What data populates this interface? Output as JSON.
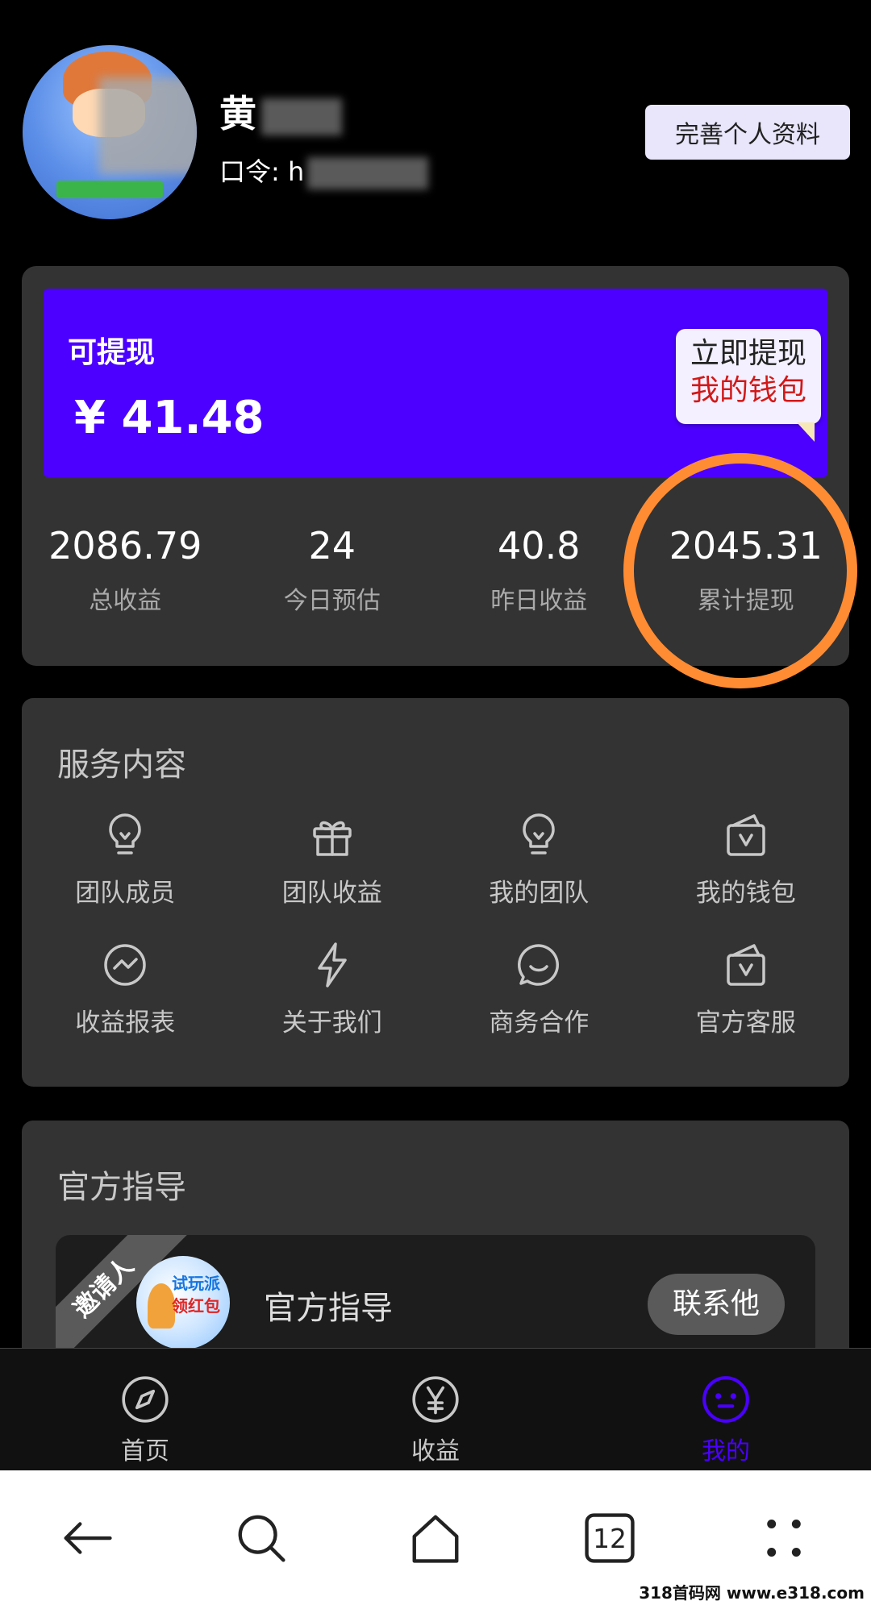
{
  "header": {
    "user_name_visible": "黄",
    "code_label": "口令: h",
    "profile_button": "完善个人资料"
  },
  "earnings": {
    "withdrawable_label": "可提现",
    "withdrawable_amount": "¥ 41.48",
    "withdraw_button_line1": "立即提现",
    "withdraw_button_line2": "我的钱包",
    "stats": [
      {
        "value": "2086.79",
        "label": "总收益"
      },
      {
        "value": "24",
        "label": "今日预估"
      },
      {
        "value": "40.8",
        "label": "昨日收益"
      },
      {
        "value": "2045.31",
        "label": "累计提现"
      }
    ]
  },
  "services": {
    "title": "服务内容",
    "items": [
      {
        "label": "团队成员",
        "icon": "lightbulb-icon"
      },
      {
        "label": "团队收益",
        "icon": "gift-icon"
      },
      {
        "label": "我的团队",
        "icon": "lightbulb-icon"
      },
      {
        "label": "我的钱包",
        "icon": "wallet-icon"
      },
      {
        "label": "收益报表",
        "icon": "chart-icon"
      },
      {
        "label": "关于我们",
        "icon": "lightning-icon"
      },
      {
        "label": "商务合作",
        "icon": "chat-icon"
      },
      {
        "label": "官方客服",
        "icon": "wallet-icon"
      }
    ]
  },
  "guide": {
    "title": "官方指导",
    "ribbon": "邀请人",
    "avatar_text_1": "试玩派",
    "avatar_text_2": "领红包",
    "inviter_name": "官方指导",
    "contact_button": "联系他"
  },
  "tabbar": {
    "items": [
      {
        "label": "首页",
        "icon": "compass-icon",
        "active": false
      },
      {
        "label": "收益",
        "icon": "yen-icon",
        "active": false
      },
      {
        "label": "我的",
        "icon": "face-icon",
        "active": true
      }
    ],
    "active_color": "#4a00ff"
  },
  "system_nav": {
    "tabs_count": "12"
  },
  "watermark": "318首码网 www.e318.com",
  "colors": {
    "background": "#000000",
    "card": "#333333",
    "withdraw_panel": "#4c00ff",
    "highlight_ring": "#ff8c33",
    "withdraw_red": "#d21818"
  }
}
